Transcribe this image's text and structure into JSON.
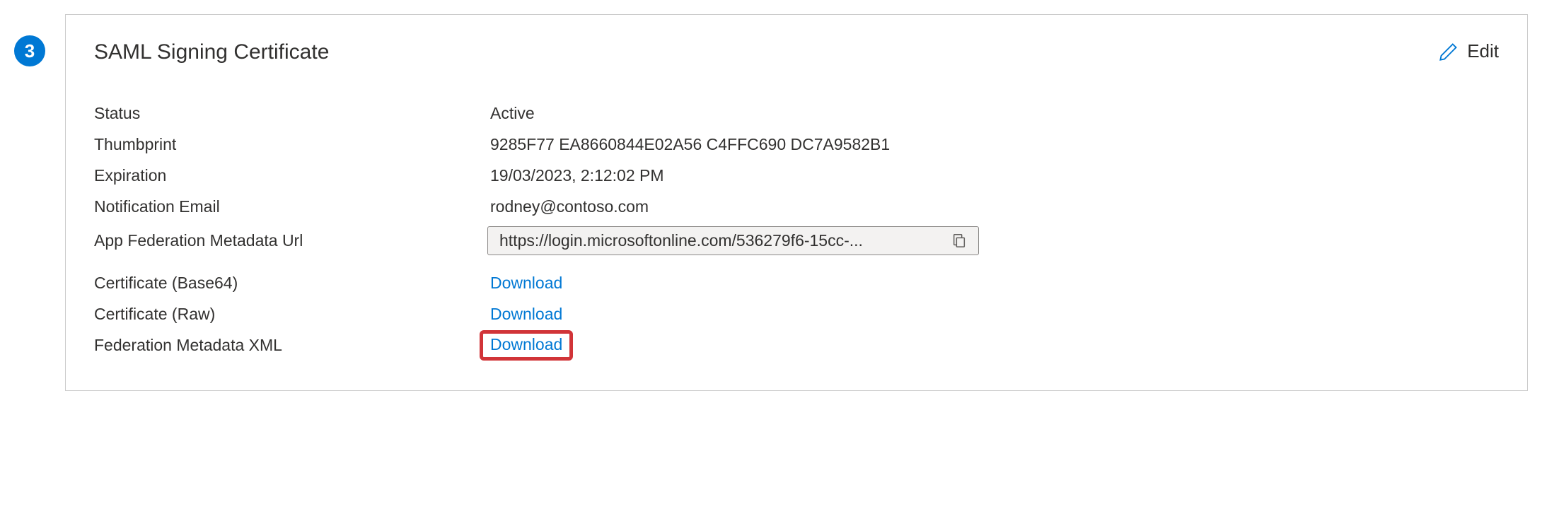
{
  "step": {
    "number": "3"
  },
  "card": {
    "title": "SAML Signing Certificate",
    "edit_label": "Edit"
  },
  "fields": {
    "status": {
      "label": "Status",
      "value": "Active"
    },
    "thumbprint": {
      "label": "Thumbprint",
      "value": "9285F77 EA8660844E02A56 C4FFC690 DC7A9582B1"
    },
    "expiration": {
      "label": "Expiration",
      "value": "19/03/2023, 2:12:02 PM"
    },
    "notification_email": {
      "label": "Notification Email",
      "value": "rodney@contoso.com"
    },
    "metadata_url": {
      "label": "App Federation Metadata Url",
      "value": "https://login.microsoftonline.com/536279f6-15cc-..."
    },
    "cert_base64": {
      "label": "Certificate (Base64)",
      "link": "Download"
    },
    "cert_raw": {
      "label": "Certificate (Raw)",
      "link": "Download"
    },
    "fed_metadata_xml": {
      "label": "Federation Metadata XML",
      "link": "Download"
    }
  }
}
